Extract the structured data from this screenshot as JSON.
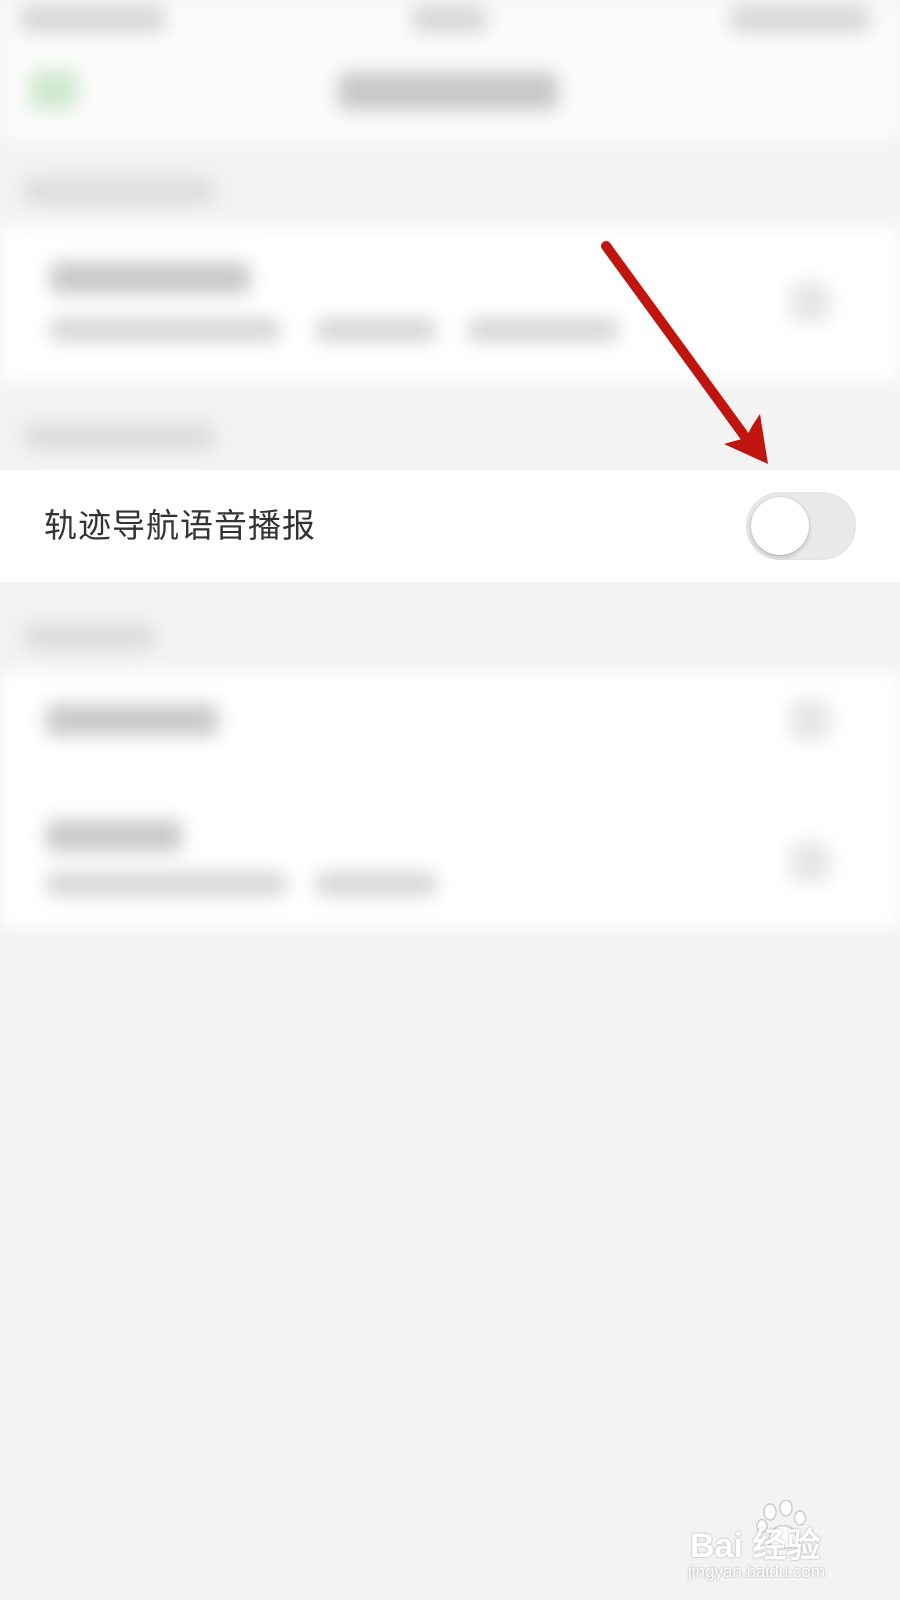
{
  "settings": {
    "track_nav_voice": {
      "label": "轨迹导航语音播报",
      "enabled": false
    }
  },
  "annotation": {
    "arrow_color": "#c0150f"
  },
  "watermark": {
    "logo": "Bai  经验",
    "site": "jingyan.baidu.com"
  },
  "colors": {
    "background": "#f3f3f3",
    "row_background": "#ffffff",
    "label_text": "#333333",
    "toggle_off_track": "#e9e9ea"
  }
}
